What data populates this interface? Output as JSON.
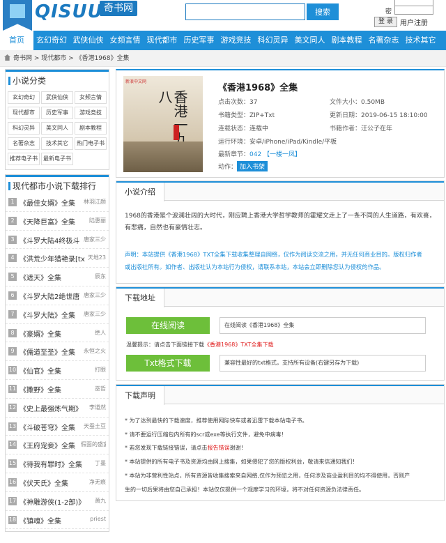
{
  "logo": {
    "text": "QISUU",
    "cn": "奇书网"
  },
  "search": {
    "button": "搜索"
  },
  "login": {
    "password_label": "密  码：",
    "login_button": "登 录",
    "register_link": "用户注册"
  },
  "nav": [
    "首页",
    "玄幻奇幻",
    "武侠仙侠",
    "女频言情",
    "现代都市",
    "历史军事",
    "游戏竞技",
    "科幻灵异",
    "美文同人",
    "剧本教程",
    "名著杂志",
    "技术其它"
  ],
  "breadcrumb": {
    "home": "奇书网",
    "sep1": " > ",
    "category": "现代都市",
    "sep2": " > ",
    "current": "《香港1968》全集"
  },
  "sidebar": {
    "categories_title": "小说分类",
    "categories": [
      "玄幻奇幻",
      "武侠仙侠",
      "女频言情",
      "现代都市",
      "历史军事",
      "游戏竞技",
      "科幻灵异",
      "美文同人",
      "剧本教程",
      "名著杂志",
      "技术其它",
      "热门电子书",
      "推荐电子书",
      "最新电子书"
    ],
    "ranking_title": "现代都市小说下载排行",
    "ranking": [
      {
        "n": "1",
        "title": "《最佳女婿》全集",
        "author": "林羽江颜"
      },
      {
        "n": "2",
        "title": "《天降巨富》全集",
        "author": "陆惠丽"
      },
      {
        "n": "3",
        "title": "《斗罗大陆4终极斗",
        "author": "唐家三少"
      },
      {
        "n": "4",
        "title": "《洪荒少年猎艳录[txt",
        "author": "天地23"
      },
      {
        "n": "5",
        "title": "《遮天》全集",
        "author": "辰东"
      },
      {
        "n": "6",
        "title": "《斗罗大陆2绝世唐",
        "author": "唐家三少"
      },
      {
        "n": "7",
        "title": "《斗罗大陆》全集",
        "author": "唐家三少"
      },
      {
        "n": "8",
        "title": "《豪婿》全集",
        "author": "绝人"
      },
      {
        "n": "9",
        "title": "《儒道至圣》全集",
        "author": "永恒之火"
      },
      {
        "n": "10",
        "title": "《仙官》全集",
        "author": "打眼"
      },
      {
        "n": "11",
        "title": "《撒野》全集",
        "author": "巫哲"
      },
      {
        "n": "12",
        "title": "《史上最强炼气期》",
        "author": "李道然"
      },
      {
        "n": "13",
        "title": "《斗破苍穹》全集",
        "author": "天蚕土豆"
      },
      {
        "n": "14",
        "title": "《王府宠妾》全集",
        "author": "假面的盛宴"
      },
      {
        "n": "15",
        "title": "《待我有罪时》全集",
        "author": "丁墨"
      },
      {
        "n": "16",
        "title": "《伏天氏》全集",
        "author": "净无痕"
      },
      {
        "n": "17",
        "title": "《神雕游侠(1-2部)》全",
        "author": "萧九"
      },
      {
        "n": "18",
        "title": "《镇魂》全集",
        "author": "priest"
      }
    ]
  },
  "book": {
    "cover_tag": "新浪中文网",
    "cover_title": "香港一九六八",
    "title": "《香港1968》全集",
    "clicks_label": "点击次数：",
    "clicks": "37",
    "size_label": "文件大小：",
    "size": "0.50MB",
    "type_label": "书籍类型：",
    "type": "ZIP+Txt",
    "updated_label": "更新日期：",
    "updated": "2019-06-15 18:10:00",
    "status_label": "连载状态：",
    "status": "连载中",
    "author_label": "书籍作者：",
    "author": "汪公子在年",
    "env_label": "运行环境：",
    "env": "安卓/iPhone/iPad/Kindle/平板",
    "latest_label": "最新章节：",
    "latest": "042 【一楼一凤】",
    "action_label": "动作：",
    "action_button": "加入书架"
  },
  "intro": {
    "heading": "小说介绍",
    "text": "1968的香港是个波澜壮阔的大时代，刚应聘上香港大学哲学教师的霍耀文走上了一条不同的人生道路，有欢喜，有悲痛，自然也有豪情壮志。",
    "notice_a": "声明：本站提供《香港1968》TXT全集下载收集整理自网络，仅作为阅读交流之用，并无任何商业目的。版权归作者",
    "notice_b": "或出版社所有。如作者、出版社认为本站行为侵权，请联系本站，本站会立即删除您认为侵权的作品。"
  },
  "download": {
    "heading": "下载地址",
    "online_button": "在线阅读",
    "online_desc": "在线阅读《香港1968》全集",
    "tip_prefix": "温馨提示：请点击下面链接下载",
    "tip_link": "《香港1968》TXT全集下载",
    "txt_button": "Txt格式下载",
    "txt_desc": "兼容性最好的txt格式，支持所有设备(右键另存为下载)"
  },
  "statement": {
    "heading": "下载声明",
    "lines": [
      "* 为了达到最快的下载速度，推荐使用网际快车或者迅雷下载本站电子书。",
      "* 请不要运行压缩包内所有的scr或exe等执行文件，避免中病毒！",
      "* 本站提供的所有电子书及资源均由网上搜集，如果侵犯了您的版权利益，敬请来信通知我们！",
      "* 本站为非营利性站点，所有资源皆收集搜索来自网络,仅作为预览之用，任何涉及商业盈利目的均不得使用，否则产",
      "生的一切后果将由您自己承担！本站仅仅提供一个观摩学习的环境，将不对任何资源负法律责任。"
    ],
    "report_prefix": "* 若您发现下载链接错误，请点击",
    "report_link": "报告错误",
    "report_suffix": "谢谢！"
  },
  "colors": {
    "primary": "#1e8fd8",
    "green": "#6dbf3a",
    "red": "#e02020"
  }
}
